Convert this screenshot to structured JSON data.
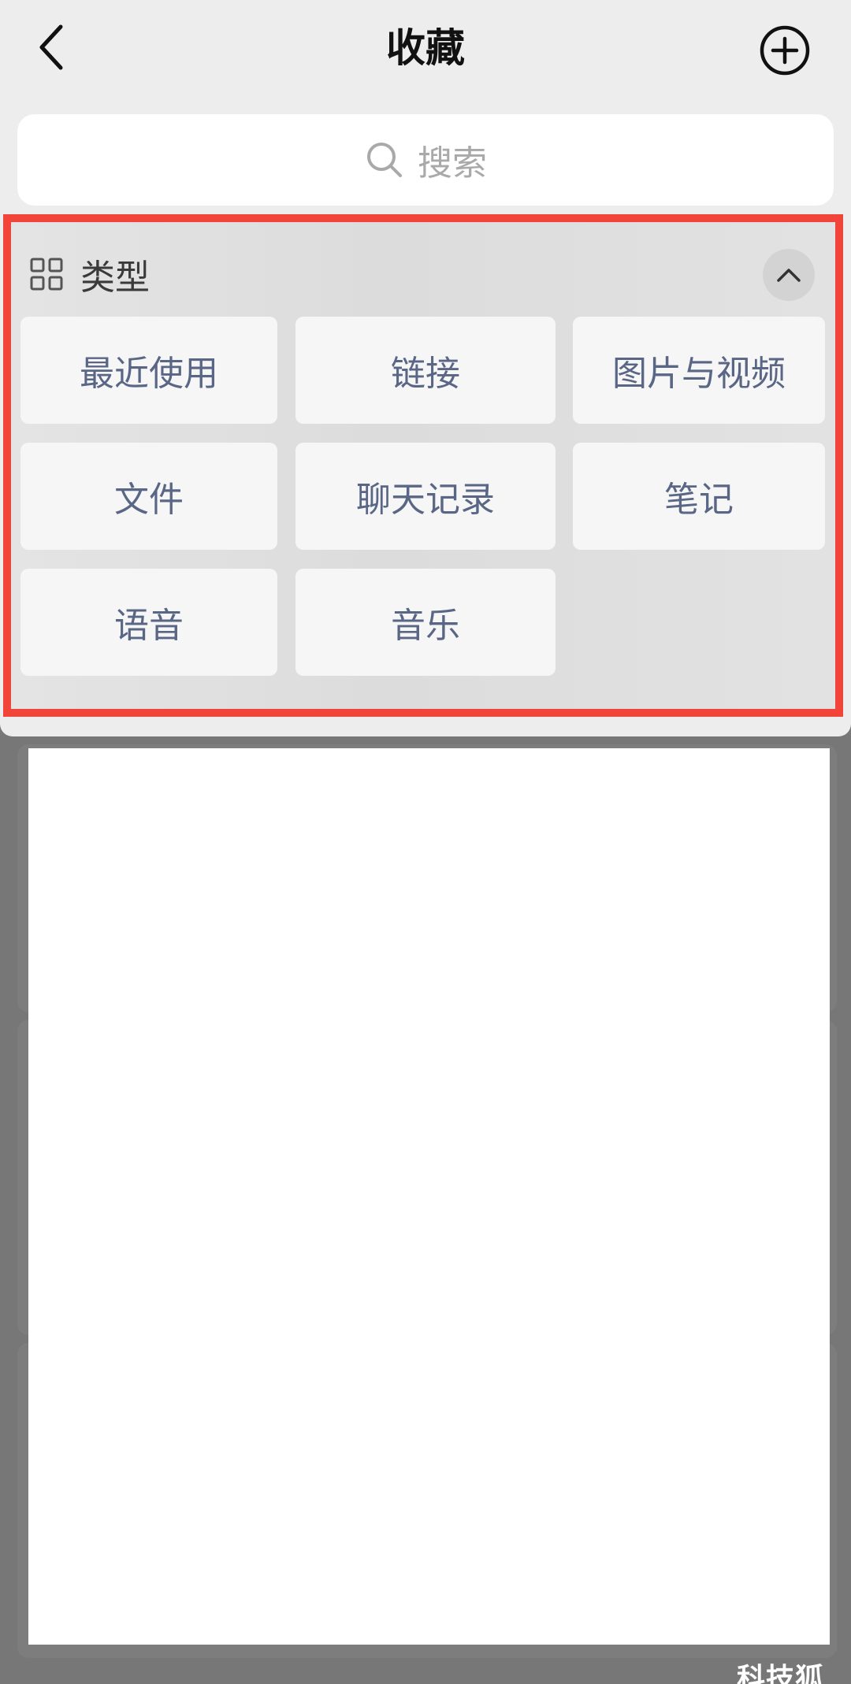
{
  "header": {
    "title": "收藏"
  },
  "search": {
    "placeholder": "搜索"
  },
  "type_panel": {
    "title": "类型",
    "items": [
      {
        "label": "最近使用"
      },
      {
        "label": "链接"
      },
      {
        "label": "图片与视频"
      },
      {
        "label": "文件"
      },
      {
        "label": "聊天记录"
      },
      {
        "label": "笔记"
      },
      {
        "label": "语音"
      },
      {
        "label": "音乐"
      }
    ]
  },
  "watermark": {
    "text": "科技狐"
  },
  "colors": {
    "highlight": "#f2453a",
    "tile_text": "#5a6685",
    "background": "#ededed",
    "overlay": "#777777"
  },
  "icons": {
    "back": "chevron-left-icon",
    "add": "plus-circle-icon",
    "search": "search-icon",
    "grid": "grid-icon",
    "collapse": "chevron-up-icon"
  }
}
